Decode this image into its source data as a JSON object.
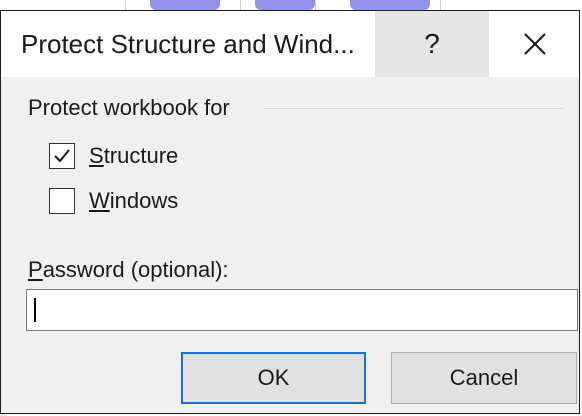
{
  "dialog": {
    "title": "Protect Structure and Wind...",
    "help_label": "?",
    "close_label": "close",
    "group_label": "Protect workbook for",
    "options": [
      {
        "mnemonic": "S",
        "rest": "tructure",
        "checked": true
      },
      {
        "mnemonic": "W",
        "rest": "indows",
        "checked": false
      }
    ],
    "password_label_mnemonic": "P",
    "password_label_rest": "assword (optional):",
    "password_value": "",
    "ok_label": "OK",
    "cancel_label": "Cancel"
  },
  "colors": {
    "dialog_bg": "#f0f0f0",
    "titlebar_bg": "#ffffff",
    "help_hover_bg": "#e5e5e5",
    "ok_border": "#1a73d0",
    "button_bg": "#e1e1e1"
  }
}
